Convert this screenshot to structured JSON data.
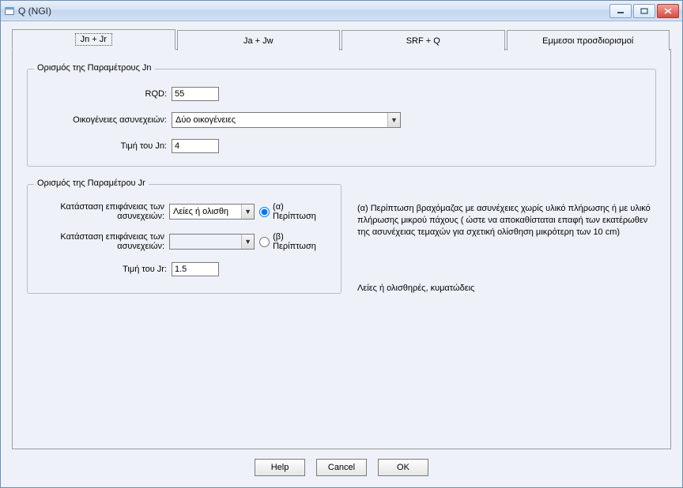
{
  "window": {
    "title": "Q (NGI)"
  },
  "tabs": {
    "t0": "Jn + Jr",
    "t1": "Ja + Jw",
    "t2": "SRF + Q",
    "t3": "Εμμεσοι προσδιορισμοί"
  },
  "jn": {
    "legend": "Ορισμός της Παραμέτρους Jn",
    "rqd_label": "RQD:",
    "rqd_value": "55",
    "fam_label": "Οικογένειες ασυνεχειών:",
    "fam_value": "Δύο οικογένειες",
    "jn_label": "Τιμή του Jn:",
    "jn_value": "4"
  },
  "jr": {
    "legend": "Ορισμός της Παραμέτρου Jr",
    "surf1_label": "Κατάσταση επιφάνειας των ασυνεχειών:",
    "surf1_value": "Λείες ή ολισθη",
    "radio_a": "(α) Περίπτωση",
    "surf2_label": "Κατάσταση επιφάνειας των ασυνεχειών:",
    "surf2_value": "",
    "radio_b": "(β) Περίπτωση",
    "jr_label": "Τιμή του Jr:",
    "jr_value": "1.5",
    "note_a": "(α) Περίπτωση  βραχόμαζας με ασυνέχειες χωρίς υλικό πλήρωσης ή με υλικό πλήρωσης μικρού πάχους ( ώστε να αποκαθίσταται επαφή των εκατέρωθεν της ασυνέχειας τεμαχών για σχετική ολίσθηση μικρότερη των 10 cm)",
    "note_bottom": "Λείες ή ολισθηρές, κυματώδεις"
  },
  "buttons": {
    "help": "Help",
    "cancel": "Cancel",
    "ok": "OK"
  }
}
